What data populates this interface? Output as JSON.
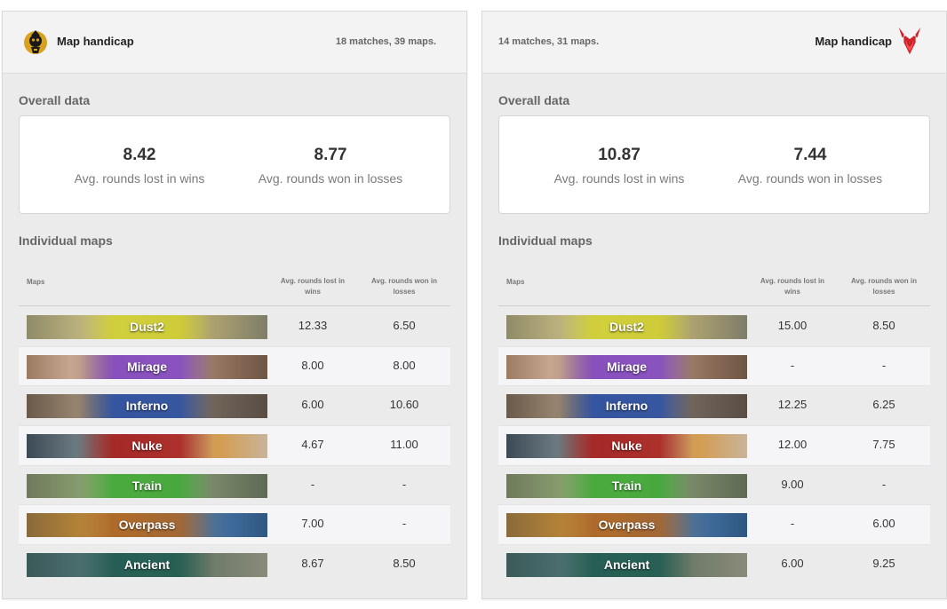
{
  "left": {
    "title": "Map handicap",
    "meta": "18 matches, 39 maps.",
    "logo": "team-logo-icon",
    "overall_label": "Overall data",
    "overall": {
      "avg_lost_in_wins": "8.42",
      "avg_lost_in_wins_label": "Avg. rounds lost in wins",
      "avg_won_in_losses": "8.77",
      "avg_won_in_losses_label": "Avg. rounds won in losses"
    },
    "individual_label": "Individual maps",
    "table": {
      "col_maps": "Maps",
      "col_lost": "Avg. rounds lost in wins",
      "col_won": "Avg. rounds won in losses",
      "rows": [
        {
          "map": "Dust2",
          "lost": "12.33",
          "won": "6.50"
        },
        {
          "map": "Mirage",
          "lost": "8.00",
          "won": "8.00"
        },
        {
          "map": "Inferno",
          "lost": "6.00",
          "won": "10.60"
        },
        {
          "map": "Nuke",
          "lost": "4.67",
          "won": "11.00"
        },
        {
          "map": "Train",
          "lost": "-",
          "won": "-"
        },
        {
          "map": "Overpass",
          "lost": "7.00",
          "won": "-"
        },
        {
          "map": "Ancient",
          "lost": "8.67",
          "won": "8.50"
        }
      ]
    }
  },
  "right": {
    "title": "Map handicap",
    "meta": "14 matches, 31 maps.",
    "logo": "team-logo-icon",
    "overall_label": "Overall data",
    "overall": {
      "avg_lost_in_wins": "10.87",
      "avg_lost_in_wins_label": "Avg. rounds lost in wins",
      "avg_won_in_losses": "7.44",
      "avg_won_in_losses_label": "Avg. rounds won in losses"
    },
    "individual_label": "Individual maps",
    "table": {
      "col_maps": "Maps",
      "col_lost": "Avg. rounds lost in wins",
      "col_won": "Avg. rounds won in losses",
      "rows": [
        {
          "map": "Dust2",
          "lost": "15.00",
          "won": "8.50"
        },
        {
          "map": "Mirage",
          "lost": "-",
          "won": "-"
        },
        {
          "map": "Inferno",
          "lost": "12.25",
          "won": "6.25"
        },
        {
          "map": "Nuke",
          "lost": "12.00",
          "won": "7.75"
        },
        {
          "map": "Train",
          "lost": "9.00",
          "won": "-"
        },
        {
          "map": "Overpass",
          "lost": "-",
          "won": "6.00"
        },
        {
          "map": "Ancient",
          "lost": "6.00",
          "won": "9.25"
        }
      ]
    }
  }
}
